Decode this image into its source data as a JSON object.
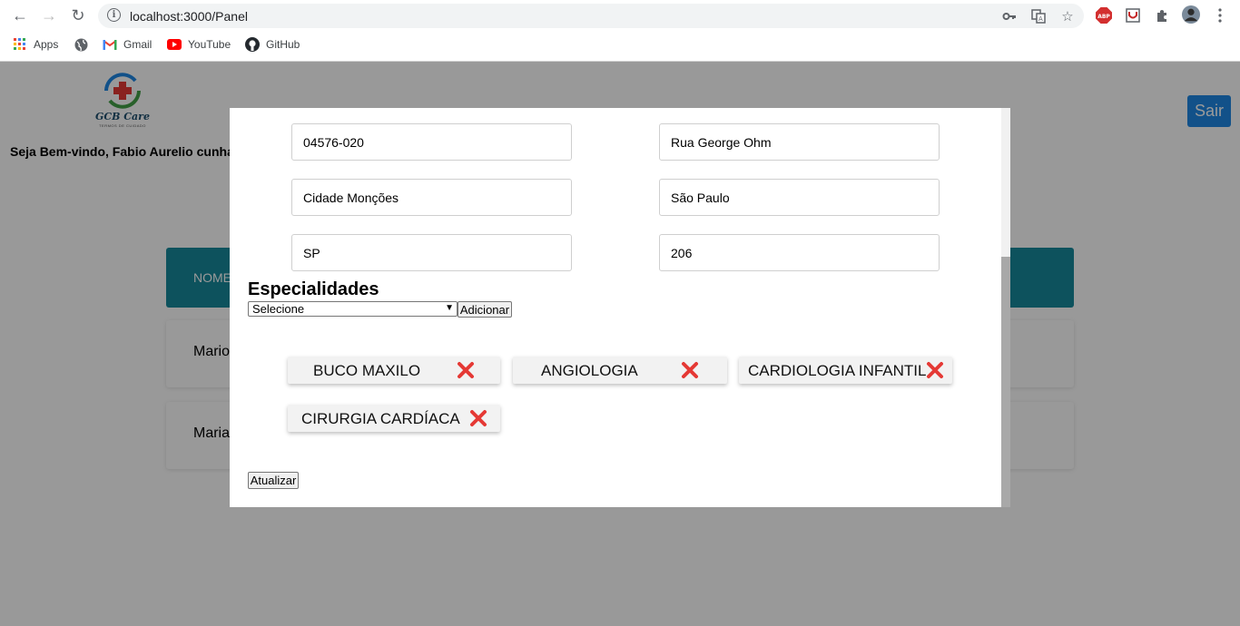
{
  "browser": {
    "url": "localhost:3000/Panel",
    "bookmarks": [
      {
        "label": "Apps",
        "icon": "apps-grid-icon"
      },
      {
        "label": "",
        "icon": "globe-icon"
      },
      {
        "label": "Gmail",
        "icon": "gmail-icon"
      },
      {
        "label": "YouTube",
        "icon": "youtube-icon"
      },
      {
        "label": "GitHub",
        "icon": "github-icon"
      }
    ],
    "extensions": {
      "abp": "ABP"
    }
  },
  "header": {
    "logo_text": "GCB Care",
    "logo_tagline": "TERMOS DE CUIDADO",
    "welcome": "Seja Bem-vindo, Fabio Aurelio cunha",
    "logout_label": "Sair"
  },
  "table": {
    "header_label": "NOME",
    "rows": [
      "Mario",
      "Maria"
    ]
  },
  "modal": {
    "fields": {
      "cep": "04576-020",
      "street": "Rua George Ohm",
      "neighborhood": "Cidade Monções",
      "city": "São Paulo",
      "state": "SP",
      "number": "206"
    },
    "specialties_title": "Especialidades",
    "select_value": "Selecione",
    "add_label": "Adicionar",
    "chips": [
      "BUCO MAXILO",
      "ANGIOLOGIA",
      "CARDIOLOGIA INFANTIL",
      "CIRURGIA CARDÍACA"
    ],
    "update_label": "Atualizar"
  },
  "colors": {
    "table_header": "#17899b",
    "logout_button": "#1e88e5",
    "remove_icon": "#e53935"
  }
}
